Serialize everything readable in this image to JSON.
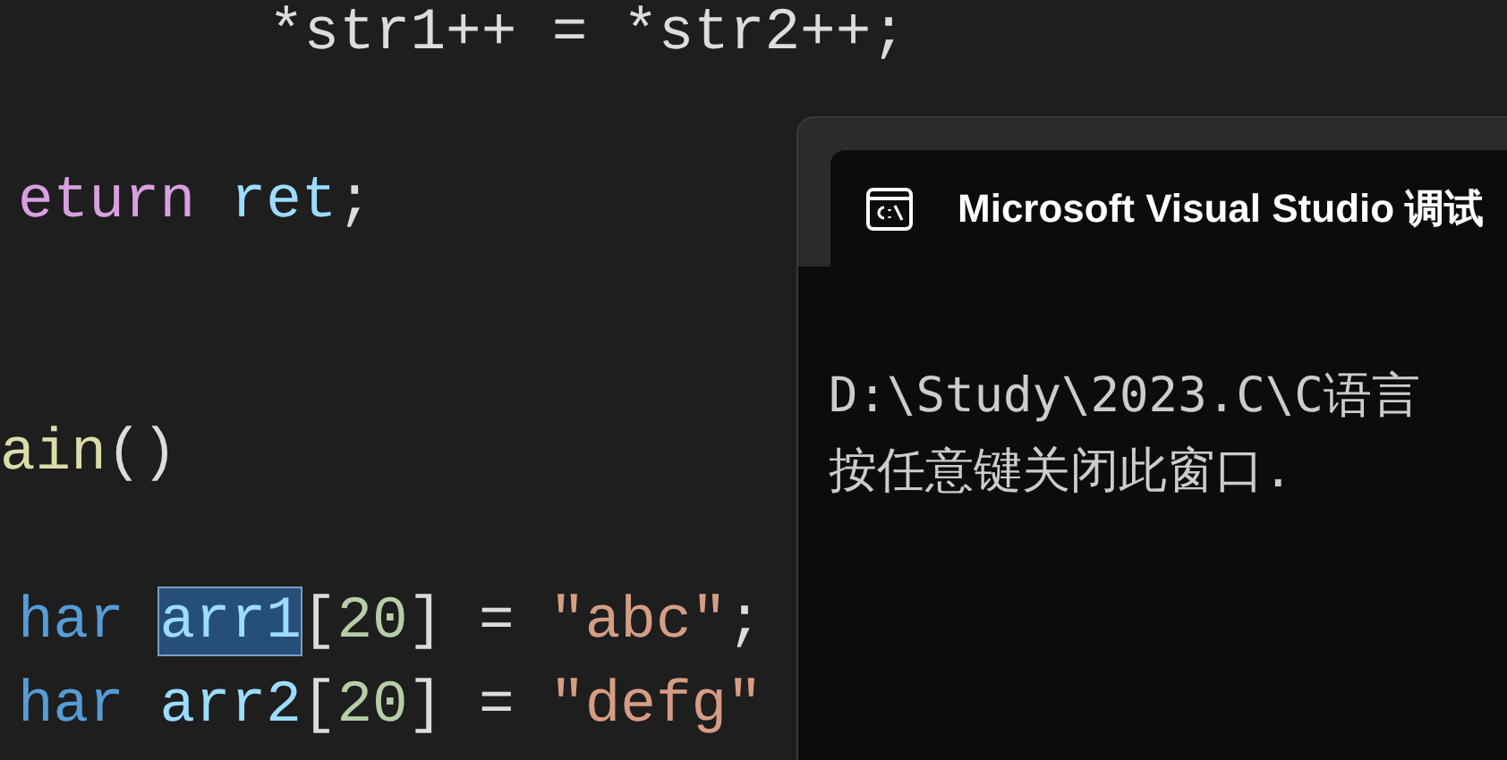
{
  "editor": {
    "lines": [
      {
        "kind": "indented",
        "tokens": [
          {
            "text": "*str1++ = *str2++;",
            "kind": "plain"
          }
        ]
      },
      {
        "kind": "blank"
      },
      {
        "kind": "code",
        "tokens": [
          {
            "text": "eturn",
            "kind": "keyword"
          },
          {
            "text": "ret",
            "kind": "ident"
          },
          {
            "text": ";",
            "kind": "plain"
          }
        ]
      },
      {
        "kind": "blank"
      },
      {
        "kind": "blank"
      },
      {
        "kind": "shallow",
        "tokens": [
          {
            "text": "ain",
            "kind": "func"
          },
          {
            "text": "()",
            "kind": "plain"
          }
        ]
      },
      {
        "kind": "blank"
      },
      {
        "kind": "code",
        "tokens": [
          {
            "text": "har",
            "kind": "type"
          },
          {
            "text": "arr1",
            "kind": "highlighted"
          },
          {
            "text": "[",
            "kind": "plain"
          },
          {
            "text": "20",
            "kind": "number"
          },
          {
            "text": "] =",
            "kind": "plain"
          },
          {
            "text": "\"abc\"",
            "kind": "string"
          },
          {
            "text": ";",
            "kind": "plain"
          }
        ]
      },
      {
        "kind": "code",
        "tokens": [
          {
            "text": "har",
            "kind": "type"
          },
          {
            "text": "arr2",
            "kind": "ident"
          },
          {
            "text": "[",
            "kind": "plain"
          },
          {
            "text": "20",
            "kind": "number"
          },
          {
            "text": "] =",
            "kind": "plain"
          },
          {
            "text": "\"defg\"",
            "kind": "string"
          }
        ]
      }
    ]
  },
  "console": {
    "title": "Microsoft Visual Studio 调试",
    "lines": [
      "D:\\Study\\2023.C\\C语言",
      "按任意键关闭此窗口."
    ]
  }
}
